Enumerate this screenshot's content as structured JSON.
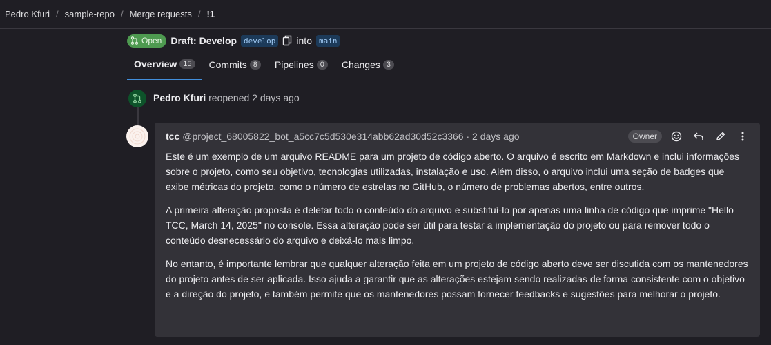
{
  "breadcrumb": {
    "items": [
      "Pedro Kfuri",
      "sample-repo",
      "Merge requests"
    ],
    "current": "!1"
  },
  "mr": {
    "status": "Open",
    "title": "Draft: Develop",
    "source_branch": "develop",
    "into": "into",
    "target_branch": "main"
  },
  "tabs": [
    {
      "label": "Overview",
      "count": "15"
    },
    {
      "label": "Commits",
      "count": "8"
    },
    {
      "label": "Pipelines",
      "count": "0"
    },
    {
      "label": "Changes",
      "count": "3"
    }
  ],
  "event": {
    "author": "Pedro Kfuri",
    "action": "reopened 2 days ago"
  },
  "note": {
    "author": "tcc",
    "handle": "@project_68005822_bot_a5cc7c5d530e314abb62ad30d52c3366 · 2 days ago",
    "role": "Owner",
    "paragraphs": [
      "Este é um exemplo de um arquivo README para um projeto de código aberto. O arquivo é escrito em Markdown e inclui informações sobre o projeto, como seu objetivo, tecnologias utilizadas, instalação e uso. Além disso, o arquivo inclui uma seção de badges que exibe métricas do projeto, como o número de estrelas no GitHub, o número de problemas abertos, entre outros.",
      "A primeira alteração proposta é deletar todo o conteúdo do arquivo e substituí-lo por apenas uma linha de código que imprime \"Hello TCC, March 14, 2025\" no console. Essa alteração pode ser útil para testar a implementação do projeto ou para remover todo o conteúdo desnecessário do arquivo e deixá-lo mais limpo.",
      "No entanto, é importante lembrar que qualquer alteração feita em um projeto de código aberto deve ser discutida com os mantenedores do projeto antes de ser aplicada. Isso ajuda a garantir que as alterações estejam sendo realizadas de forma consistente com o objetivo e a direção do projeto, e também permite que os mantenedores possam fornecer feedbacks e sugestões para melhorar o projeto."
    ]
  },
  "icons": {
    "status": "merge-request-icon",
    "copy": "copy-icon",
    "event": "merge-request-reopen-icon",
    "emoji": "smiley-icon",
    "reply": "reply-icon",
    "edit": "pencil-icon",
    "more": "kebab-icon"
  },
  "colors": {
    "background": "#1f1e24",
    "note_background": "#333238",
    "open_badge": "#4e9a50",
    "active_tab": "#428fdc",
    "branch_background": "#1c3a59"
  }
}
